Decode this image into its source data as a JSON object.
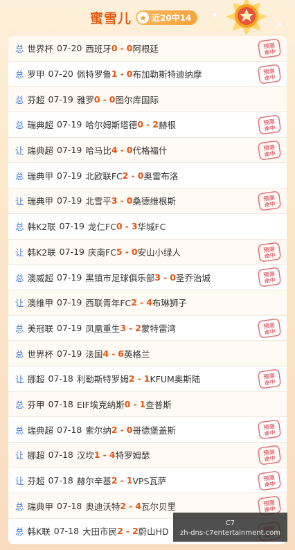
{
  "header": {
    "title": "蜜雪儿",
    "badge_icon": "star-icon",
    "badge_text": "近20中14"
  },
  "stamp_text": "预测命中",
  "rows": [
    {
      "type": "总",
      "league": "世界杯",
      "date": "07-20",
      "home": "西班牙",
      "home_score": "0",
      "sep": "-",
      "away_score": "0",
      "away": "阿根廷",
      "hit": true
    },
    {
      "type": "总",
      "league": "罗甲",
      "date": "07-20",
      "home": "佩特罗鲁",
      "home_score": "1",
      "sep": "-",
      "away_score": "0",
      "away": "布加勒斯特迪纳摩",
      "hit": true
    },
    {
      "type": "总",
      "league": "芬超",
      "date": "07-19",
      "home": "雅罗",
      "home_score": "0",
      "sep": "-",
      "away_score": "0",
      "away": "图尔库国际",
      "hit": false
    },
    {
      "type": "总",
      "league": "瑞典超",
      "date": "07-19",
      "home": "哈尔姆斯塔德",
      "home_score": "0",
      "sep": "-",
      "away_score": "2",
      "away": "赫根",
      "hit": true
    },
    {
      "type": "让",
      "league": "瑞典超",
      "date": "07-19",
      "home": "哈马比",
      "home_score": "4",
      "sep": "-",
      "away_score": "0",
      "away": "代格福什",
      "hit": true
    },
    {
      "type": "总",
      "league": "瑞典甲",
      "date": "07-19",
      "home": "北欧联FC",
      "home_score": "2",
      "sep": "-",
      "away_score": "0",
      "away": "奥雷布洛",
      "hit": false
    },
    {
      "type": "让",
      "league": "瑞典甲",
      "date": "07-19",
      "home": "北雪平",
      "home_score": "3",
      "sep": "-",
      "away_score": "0",
      "away": "桑德维根斯",
      "hit": true
    },
    {
      "type": "总",
      "league": "韩K2联",
      "date": "07-19",
      "home": "龙仁FC",
      "home_score": "0",
      "sep": "-",
      "away_score": "3",
      "away": "华城FC",
      "hit": false
    },
    {
      "type": "让",
      "league": "韩K2联",
      "date": "07-19",
      "home": "庆南FC",
      "home_score": "5",
      "sep": "-",
      "away_score": "0",
      "away": "安山小绿人",
      "hit": true
    },
    {
      "type": "总",
      "league": "澳威超",
      "date": "07-19",
      "home": "黑镇市足球俱乐部",
      "home_score": "3",
      "sep": "-",
      "away_score": "0",
      "away": "圣乔治城",
      "hit": true
    },
    {
      "type": "让",
      "league": "澳维甲",
      "date": "07-19",
      "home": "西联青年FC",
      "home_score": "2",
      "sep": "-",
      "away_score": "4",
      "away": "布琳狮子",
      "hit": false
    },
    {
      "type": "总",
      "league": "美冠联",
      "date": "07-19",
      "home": "凤凰重生",
      "home_score": "3",
      "sep": "-",
      "away_score": "2",
      "away": "蒙特雷湾",
      "hit": true
    },
    {
      "type": "总",
      "league": "世界杯",
      "date": "07-19",
      "home": "法国",
      "home_score": "4",
      "sep": "-",
      "away_score": "6",
      "away": "英格兰",
      "hit": false
    },
    {
      "type": "让",
      "league": "挪超",
      "date": "07-18",
      "home": "利勒斯特罗姆",
      "home_score": "2",
      "sep": "-",
      "away_score": "1",
      "away": "KFUM奥斯陆",
      "hit": true
    },
    {
      "type": "总",
      "league": "芬甲",
      "date": "07-18",
      "home": "EIF埃克纳斯",
      "home_score": "0",
      "sep": "-",
      "away_score": "1",
      "away": "查普斯",
      "hit": false
    },
    {
      "type": "总",
      "league": "瑞典超",
      "date": "07-18",
      "home": "索尔纳",
      "home_score": "2",
      "sep": "-",
      "away_score": "0",
      "away": "哥德堡盖斯",
      "hit": true
    },
    {
      "type": "让",
      "league": "挪超",
      "date": "07-18",
      "home": "汉坎",
      "home_score": "1",
      "sep": "-",
      "away_score": "4",
      "away": "特罗姆瑟",
      "hit": true
    },
    {
      "type": "让",
      "league": "芬超",
      "date": "07-18",
      "home": "赫尔辛基",
      "home_score": "2",
      "sep": "-",
      "away_score": "1",
      "away": "VPS瓦萨",
      "hit": true
    },
    {
      "type": "总",
      "league": "瑞典甲",
      "date": "07-18",
      "home": "奥迪沃特",
      "home_score": "2",
      "sep": "-",
      "away_score": "4",
      "away": "瓦尔贝里",
      "hit": true
    },
    {
      "type": "总",
      "league": "韩K联",
      "date": "07-18",
      "home": "大田市民",
      "home_score": "2",
      "sep": "-",
      "away_score": "2",
      "away": "蔚山HD",
      "hit": true
    }
  ],
  "watermark": {
    "line1": "C7",
    "line2": "zh-dns-c7entertainment.com"
  }
}
